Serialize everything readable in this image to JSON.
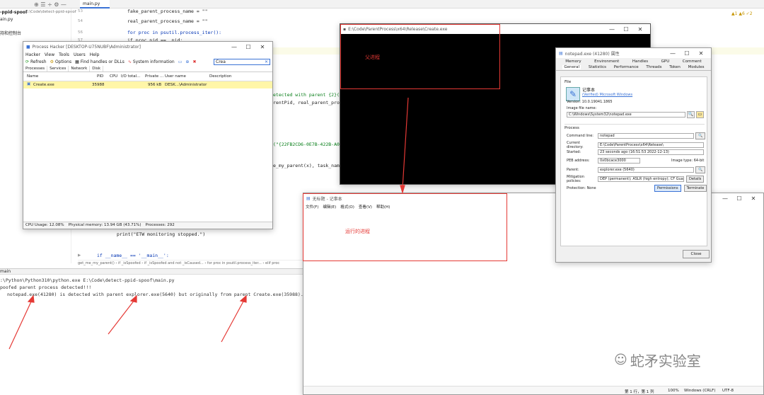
{
  "ide": {
    "project_title": "-ppid-spoof",
    "project_path": "E:\\Code\\detect-ppid-spoof",
    "file_item": "ain.py",
    "side_label": "持和控制台",
    "tab_label": "main.py",
    "status_right": "▲1 ▲6 ✓2",
    "code": [
      {
        "n": "53",
        "text": "fake_parent_process_name = \"\""
      },
      {
        "n": "54",
        "text": "real_parent_process_name = \"\""
      },
      {
        "n": "55",
        "text": ""
      },
      {
        "n": "56",
        "text": "for proc in psutil.process_iter():"
      },
      {
        "n": "57",
        "text": "    if proc.pid == _pid:"
      }
    ],
    "code_fragments": {
      "f1": "etected with parent {2}({3})",
      "f2": "rentPid, real_parent_proces",
      "f3": "(\"{22FB2CD6-0E7B-422B-A0C7-",
      "f4": "e_my_parent(x), task_name_f"
    },
    "print_line": "print(\"ETW monitoring stopped.\")",
    "main_line": "if __name__ == '__main__':",
    "breadcrumb": "get_me_my_parent()  ›  if _isSpoofed  ›  if _isSpoofed and not _isCaused...  ›  for proc in psutil.process_iter...  ›  elif proc",
    "run_tab": "main",
    "console": [
      ":\\Python\\Python310\\python.exe E:\\Code\\detect-ppid-spoof\\main.py",
      "poofed parent process detected!!!",
      "notepad.exe(41280) is detected with parent explorer.exe(5640) but originally from parent Create.exe(35988)."
    ]
  },
  "process_hacker": {
    "title": "Process Hacker [DESKTOP-U75NUBF\\Administrator]",
    "menu": [
      "Hacker",
      "View",
      "Tools",
      "Users",
      "Help"
    ],
    "toolbar": [
      "Refresh",
      "Options",
      "Find handles or DLLs",
      "System information"
    ],
    "search_value": "Crea",
    "tabs": [
      "Processes",
      "Services",
      "Network",
      "Disk"
    ],
    "columns": [
      "Name",
      "PID",
      "CPU",
      "I/O total...",
      "Private ...",
      "User name",
      "Description"
    ],
    "rows": [
      {
        "name": "Create.exe",
        "pid": "35988",
        "cpu": "",
        "io": "",
        "private": "956 kB",
        "user": "DESK...\\Administrator",
        "desc": ""
      }
    ],
    "status": [
      "CPU Usage: 12.08%",
      "Physical memory: 13.94 GB (43.71%)",
      "Processes: 292"
    ]
  },
  "console_window": {
    "title": "E:\\Code\\ParentProcess\\x64\\Release\\Create.exe",
    "annotation": "父进程"
  },
  "notepad": {
    "title": "无标题 - 记事本",
    "menu": [
      "文件(F)",
      "编辑(E)",
      "格式(O)",
      "查看(V)",
      "帮助(H)"
    ],
    "annotation": "运行的进程",
    "status": [
      "第 1 行，第 1 列",
      "100%",
      "Windows (CRLF)",
      "UTF-8"
    ]
  },
  "props": {
    "title": "notepad.exe (41280) 属性",
    "tabs_row1": [
      "Memory",
      "Environment",
      "Handles",
      "GPU",
      "Comment"
    ],
    "tabs_row2": [
      "General",
      "Statistics",
      "Performance",
      "Threads",
      "Token",
      "Modules"
    ],
    "file_header": "File",
    "app_name": "记事本",
    "verified": "(Verified) Microsoft Windows",
    "version": "Version: 10.0.19041.1865",
    "image_label": "Image file name:",
    "image_path": "C:\\Windows\\System32\\notepad.exe",
    "process_header": "Process",
    "cmd_label": "Command line:",
    "cmd_value": "notepad",
    "dir_label": "Current directory:",
    "dir_value": "E:\\Code\\ParentProcess\\x64\\Release\\",
    "started_label": "Started:",
    "started_value": "23 seconds ago (16:51:53 2022-12-13)",
    "peb_label": "PEB address:",
    "peb_value": "0x0bcace3000",
    "image_type": "Image type: 64-bit",
    "parent_label": "Parent:",
    "parent_value": "explorer.exe (5640)",
    "mitig_label": "Mitigation policies:",
    "mitig_value": "DEP (permanent); ASLR (high entropy); CF Guard",
    "details_btn": "Details",
    "protection": "Protection: None",
    "permissions_btn": "Permissions",
    "terminate_btn": "Terminate",
    "close_btn": "Close"
  },
  "watermark": "蛇矛实验室"
}
